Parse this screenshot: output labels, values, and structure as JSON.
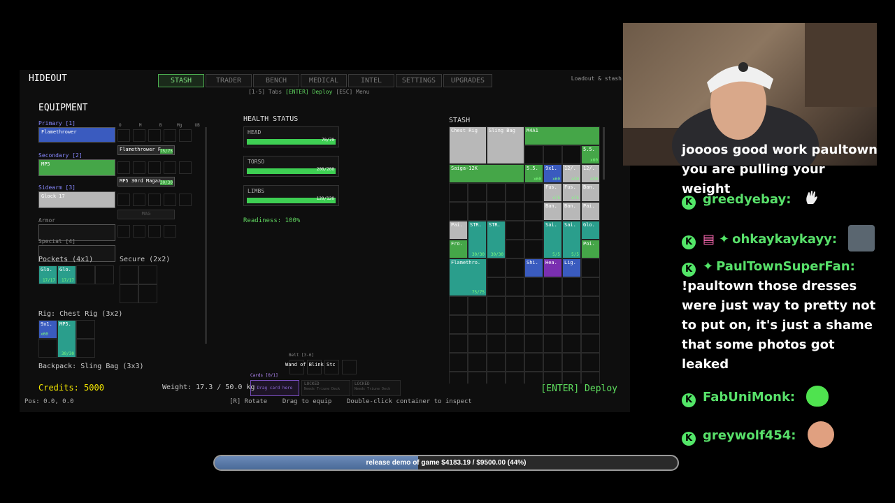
{
  "game": {
    "hideout_title": "HIDEOUT",
    "tabs": [
      "STASH",
      "TRADER",
      "BENCH",
      "MEDICAL",
      "INTEL",
      "SETTINGS",
      "UPGRADES"
    ],
    "tabs_hint_prefix": "[1-5] Tabs",
    "tabs_hint_enter": "[ENTER] Deploy",
    "tabs_hint_esc": "[ESC] Menu",
    "top_right": "Loadout & stash",
    "equipment": {
      "title": "EQUIPMENT",
      "primary_label": "Primary [1]",
      "primary_item": "Flamethrower",
      "primary_ammo": "Flamethrower F",
      "primary_ammo_qty": "75/75",
      "secondary_label": "Secondary [2]",
      "secondary_item": "MP5",
      "secondary_ammo": "MP5 30rd Magaz",
      "secondary_ammo_qty": "30/30",
      "sidearm_label": "Sidearm [3]",
      "sidearm_item": "Glock 17",
      "sidearm_ammo": "MAG",
      "armor_label": "Armor",
      "special_label": "Special [4]",
      "mod_cols": [
        "O",
        "M",
        "B",
        "Mg",
        "UB"
      ],
      "pockets_label": "Pockets (4x1)",
      "secure_label": "Secure (2x2)",
      "pocket_items": [
        {
          "name": "Glo.",
          "qty": "17/17"
        },
        {
          "name": "Glo.",
          "qty": "17/17"
        }
      ],
      "rig_label": "Rig: Chest Rig (3x2)",
      "rig_items": [
        {
          "name": "9x1.",
          "qty": "x60"
        },
        {
          "name": "MP5.",
          "qty": "30/30"
        }
      ],
      "backpack_label": "Backpack: Sling Bag (3x3)"
    },
    "health": {
      "title": "HEALTH STATUS",
      "parts": [
        {
          "label": "HEAD",
          "value": "70/70",
          "pct": 1.0
        },
        {
          "label": "TORSO",
          "value": "200/200",
          "pct": 1.0
        },
        {
          "label": "LIMBS",
          "value": "120/120",
          "pct": 1.0
        }
      ],
      "readiness": "Readiness: 100%"
    },
    "belt": {
      "label": "Belt [3-6]",
      "item": "Wand of Blink Stc",
      "slots": [
        "[3]",
        "[4]",
        "[5]",
        "[6]"
      ]
    },
    "cards": {
      "label": "Cards [0/1]",
      "drag_hint": "Drag card here",
      "locked": [
        {
          "title": "LOCKED",
          "sub": "Needs Triune Deck"
        },
        {
          "title": "LOCKED",
          "sub": "Needs Triune Deck"
        }
      ]
    },
    "stash": {
      "title": "STASH",
      "items": [
        {
          "name": "Chest Rig",
          "cls": "grey",
          "c": 0,
          "r": 0,
          "w": 2,
          "h": 2,
          "qty": ""
        },
        {
          "name": "Sling Bag",
          "cls": "grey",
          "c": 2,
          "r": 0,
          "w": 2,
          "h": 2,
          "qty": ""
        },
        {
          "name": "M4A1",
          "cls": "green",
          "c": 4,
          "r": 0,
          "w": 4,
          "h": 1,
          "qty": ""
        },
        {
          "name": "5.5.",
          "cls": "green",
          "c": 7,
          "r": 1,
          "w": 1,
          "h": 1,
          "qty": "x60"
        },
        {
          "name": "Saiga-12K",
          "cls": "green",
          "c": 0,
          "r": 2,
          "w": 4,
          "h": 1,
          "qty": ""
        },
        {
          "name": "5.5.",
          "cls": "green",
          "c": 4,
          "r": 2,
          "w": 1,
          "h": 1,
          "qty": "x60"
        },
        {
          "name": "9x1.",
          "cls": "blue",
          "c": 5,
          "r": 2,
          "w": 1,
          "h": 1,
          "qty": "x60"
        },
        {
          "name": "12/.",
          "cls": "grey",
          "c": 6,
          "r": 2,
          "w": 1,
          "h": 1,
          "qty": "x20"
        },
        {
          "name": "12/.",
          "cls": "grey",
          "c": 7,
          "r": 2,
          "w": 1,
          "h": 1,
          "qty": "x20"
        },
        {
          "name": "Fus.",
          "cls": "grey",
          "c": 5,
          "r": 3,
          "w": 1,
          "h": 1,
          "qty": "x75"
        },
        {
          "name": "Fus.",
          "cls": "grey",
          "c": 6,
          "r": 3,
          "w": 1,
          "h": 1,
          "qty": "x75"
        },
        {
          "name": "Ban.",
          "cls": "grey",
          "c": 7,
          "r": 3,
          "w": 1,
          "h": 1,
          "qty": ""
        },
        {
          "name": "Ban.",
          "cls": "grey",
          "c": 5,
          "r": 4,
          "w": 1,
          "h": 1,
          "qty": ""
        },
        {
          "name": "Ban.",
          "cls": "grey",
          "c": 6,
          "r": 4,
          "w": 1,
          "h": 1,
          "qty": ""
        },
        {
          "name": "Pai.",
          "cls": "grey",
          "c": 7,
          "r": 4,
          "w": 1,
          "h": 1,
          "qty": ""
        },
        {
          "name": "Pai.",
          "cls": "grey",
          "c": 0,
          "r": 5,
          "w": 1,
          "h": 1,
          "qty": ""
        },
        {
          "name": "STR.",
          "cls": "teal",
          "c": 1,
          "r": 5,
          "w": 1,
          "h": 2,
          "qty": "30/30"
        },
        {
          "name": "STR.",
          "cls": "teal",
          "c": 2,
          "r": 5,
          "w": 1,
          "h": 2,
          "qty": "30/30"
        },
        {
          "name": "Sai.",
          "cls": "teal",
          "c": 5,
          "r": 5,
          "w": 1,
          "h": 2,
          "qty": "5/5"
        },
        {
          "name": "Sai.",
          "cls": "teal",
          "c": 6,
          "r": 5,
          "w": 1,
          "h": 2,
          "qty": "5/5"
        },
        {
          "name": "Glo.",
          "cls": "teal",
          "c": 7,
          "r": 5,
          "w": 1,
          "h": 1,
          "qty": ""
        },
        {
          "name": "Fro.",
          "cls": "green",
          "c": 0,
          "r": 6,
          "w": 1,
          "h": 1,
          "qty": ""
        },
        {
          "name": "Poi.",
          "cls": "green",
          "c": 7,
          "r": 6,
          "w": 1,
          "h": 1,
          "qty": ""
        },
        {
          "name": "Flamethro.",
          "cls": "teal",
          "c": 0,
          "r": 7,
          "w": 2,
          "h": 2,
          "qty": "75/75"
        },
        {
          "name": "Shi.",
          "cls": "blue",
          "c": 4,
          "r": 7,
          "w": 1,
          "h": 1,
          "qty": ""
        },
        {
          "name": "Hea.",
          "cls": "purple",
          "c": 5,
          "r": 7,
          "w": 1,
          "h": 1,
          "qty": ""
        },
        {
          "name": "Lig.",
          "cls": "blue",
          "c": 6,
          "r": 7,
          "w": 1,
          "h": 1,
          "qty": ""
        }
      ]
    },
    "credits": "Credits: 5000",
    "weight": "Weight: 17.3 / 50.0 kg",
    "deploy": "[ENTER] Deploy",
    "position": "Pos: 0.0, 0.0",
    "hint_rotate": "[R] Rotate",
    "hint_drag": "Drag to equip",
    "hint_dbl": "Double-click container to inspect"
  },
  "chat": {
    "messages": [
      {
        "user": "",
        "text": "joooos good work paultown you are pulling your weight",
        "has_badge": false
      },
      {
        "user": "greedyebay:",
        "text": "",
        "has_badge": true,
        "emote": "wave-hand-icon"
      },
      {
        "user": "ohkaykaykayy:",
        "text": "",
        "has_badge": true,
        "emote": "avatar-emote"
      },
      {
        "user": "PaulTownSuperFan:",
        "text": "!paultown those dresses were just way to pretty not to put on, it's just a shame that some photos got leaked",
        "has_badge": true
      },
      {
        "user": "FabUniMonk:",
        "text": "",
        "has_badge": true,
        "emote": "green-blob-emote"
      },
      {
        "user": "greywolf454:",
        "text": "",
        "has_badge": true,
        "emote": "face-emote"
      }
    ],
    "badge_glyph": "K",
    "colors": {
      "username": "#58e06a",
      "badge": "#53e668"
    }
  },
  "donation": {
    "text": "release demo of game $4183.19 / $9500.00 (44%)",
    "progress": 0.44
  }
}
